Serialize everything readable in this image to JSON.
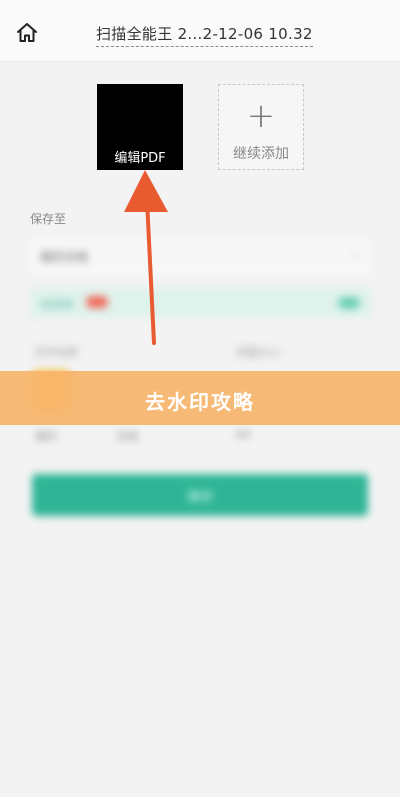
{
  "header": {
    "title": "扫描全能王 2...2-12-06 10.32",
    "home_icon": "home-icon"
  },
  "document": {
    "thumbnail_label": "编辑PDF",
    "add_more_label": "继续添加",
    "add_icon": "plus-icon"
  },
  "save_section": {
    "label": "保存至",
    "folder_value": "我的文档",
    "promo_text": "云空间"
  },
  "options": {
    "col1_label": "文件名称",
    "col2_label": "页面大小",
    "app_label": "图片",
    "app_label_2": "文档",
    "size_value": "A4"
  },
  "banner": {
    "text": "去水印攻略"
  },
  "actions": {
    "submit_label": "保存"
  },
  "colors": {
    "banner": "#f6b56c",
    "arrow": "#e85a2f",
    "primary": "#2fb596",
    "thumbnail_bg": "#000000"
  }
}
